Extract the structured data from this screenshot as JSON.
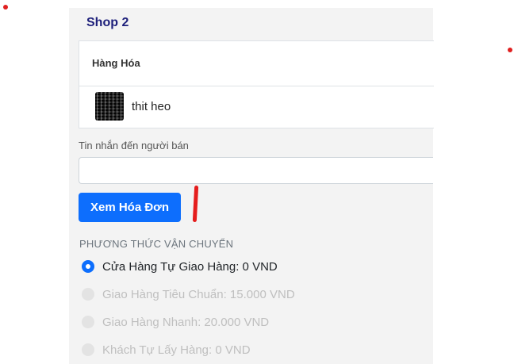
{
  "shop": {
    "name": "Shop 2",
    "column_header": "Hàng Hóa",
    "product": {
      "name": "thit heo",
      "thumbnail_icon": "qr-code-thumbnail"
    }
  },
  "message": {
    "label": "Tin nhắn đến người bán",
    "value": "",
    "placeholder": ""
  },
  "invoice_button": {
    "label": "Xem Hóa Đơn",
    "color": "#0d6efd"
  },
  "shipping": {
    "heading": "PHƯƠNG THỨC VẬN CHUYỂN",
    "options": [
      {
        "label": "Cửa Hàng Tự Giao Hàng: 0  VND",
        "selected": true,
        "disabled": false
      },
      {
        "label": "Giao Hàng Tiêu Chuẩn: 15.000  VND",
        "selected": false,
        "disabled": true
      },
      {
        "label": "Giao Hàng Nhanh: 20.000  VND",
        "selected": false,
        "disabled": true
      },
      {
        "label": "Khách Tự Lấy Hàng: 0  VND",
        "selected": false,
        "disabled": true
      }
    ]
  },
  "annotation_color": "#e51d1d"
}
